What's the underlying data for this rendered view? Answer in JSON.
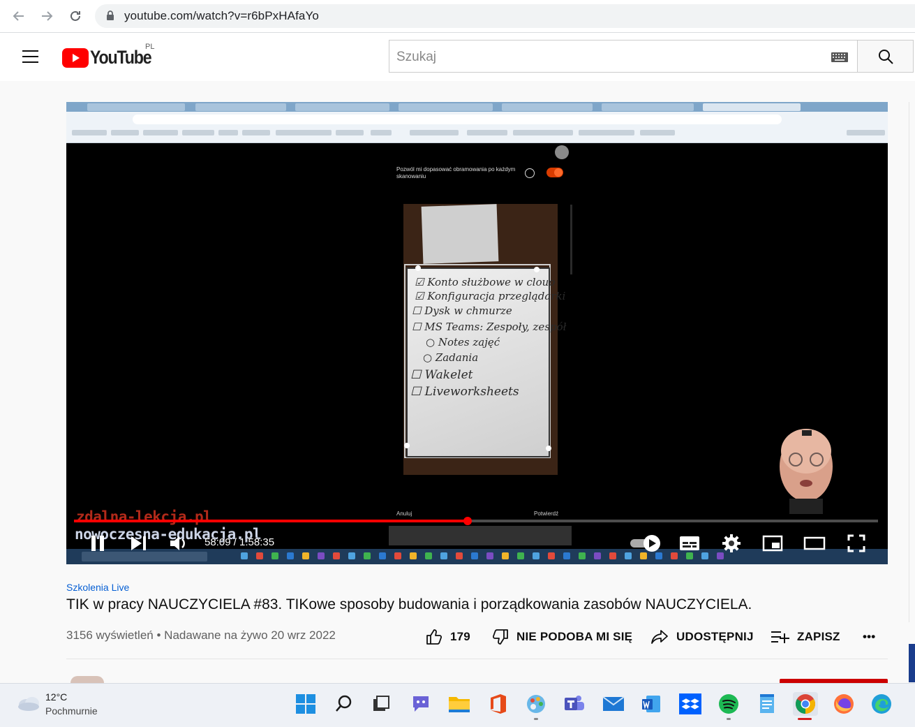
{
  "browser": {
    "url": "youtube.com/watch?v=r6bPxHAfaYo"
  },
  "youtube": {
    "logo_text": "YouTube",
    "country_code": "PL",
    "search_placeholder": "Szukaj"
  },
  "player": {
    "state": "playing",
    "current_time": "58:09",
    "duration": "1:58:35",
    "time_display": "58:09 / 1:58:35",
    "progress_fraction": 0.49,
    "autoplay": "on",
    "screen_content": {
      "scan_prompt": "Pozwól mi dopasować obramowania po każdym skanowaniu",
      "cancel_label": "Anuluj",
      "confirm_label": "Potwierdź",
      "whiteboard_lines": [
        "☑ Konto służbowe w clouo",
        "☑ Konfiguracja przeglądarki",
        "☐ Dysk w chmurze",
        "☐ MS Teams: Zespoły, zespół",
        "○ Notes zajęć",
        "○ Zadania",
        "☐ Wakelet",
        "☐ Liveworksheets"
      ],
      "watermark_top": "zdalna-lekcja.pl",
      "watermark_bottom": "nowoczesna-edukacja.pl"
    }
  },
  "video": {
    "channel": "Szkolenia Live",
    "title": "TIK w pracy NAUCZYCIELA #83. TIKowe sposoby budowania i porządkowania zasobów NAUCZYCIELA.",
    "views": "3156 wyświetleń",
    "date": "Nadawane na żywo 20 wrz 2022",
    "separator": "•",
    "likes": "179",
    "dislike_label": "NIE PODOBA MI SIĘ",
    "share_label": "UDOSTĘPNIJ",
    "save_label": "ZAPISZ",
    "more_label": "•••"
  },
  "taskbar": {
    "temperature": "12°C",
    "condition": "Pochmurnie",
    "apps": [
      "start",
      "search",
      "task-view",
      "chat",
      "file-explorer",
      "office",
      "paint",
      "teams",
      "mail",
      "word",
      "dropbox",
      "spotify",
      "notepad",
      "chrome",
      "firefox",
      "edge"
    ]
  },
  "colors": {
    "youtube_red": "#ff0000",
    "link_blue": "#065fd4",
    "text": "#0f0f0f",
    "secondary_text": "#606060"
  }
}
